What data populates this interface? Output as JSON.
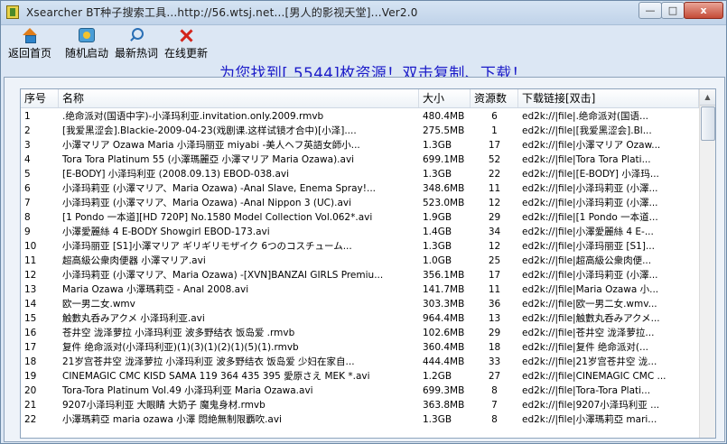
{
  "window": {
    "title": "Xsearcher BT种子搜索工具...http://56.wtsj.net...[男人的影视天堂]...Ver2.0",
    "min_label": "—",
    "max_label": "□",
    "close_label": "x"
  },
  "toolbar": {
    "home_label": "返回首页",
    "random_label": "随机启动",
    "hot_label": "最新热词",
    "update_label": "在线更新"
  },
  "banner": "为您找到[ 5544]枚资源！双击复制、下载！",
  "table": {
    "headers": {
      "index": "序号",
      "name": "名称",
      "size": "大小",
      "count": "资源数",
      "link": "下载链接[双击]"
    },
    "rows": [
      {
        "index": "1",
        "name": ".绝命派对(国语中字)-小泽玛利亚.invitation.only.2009.rmvb",
        "size": "480.4MB",
        "count": "6",
        "link": "ed2k://|file|.绝命派对(国语..."
      },
      {
        "index": "2",
        "name": "[我爱黑涩会].Blackie-2009-04-23(戏剧课.这样试镜才合中)[小泽]....",
        "size": "275.5MB",
        "count": "1",
        "link": "ed2k://|file|[我爱黑涩会].Bl..."
      },
      {
        "index": "3",
        "name": "小澤マリア Ozawa Maria 小泽玛丽亚 miyabi -美人ヘフ英語女師小...",
        "size": "1.3GB",
        "count": "17",
        "link": "ed2k://|file|小澤マリア Ozaw..."
      },
      {
        "index": "4",
        "name": "Tora Tora Platinum 55 (小澤瑪麗亞 小澤マリア Maria Ozawa).avi",
        "size": "699.1MB",
        "count": "52",
        "link": "ed2k://|file|Tora Tora Plati..."
      },
      {
        "index": "5",
        "name": "[E-BODY] 小泽玛利亚 (2008.09.13) EBOD-038.avi",
        "size": "1.3GB",
        "count": "22",
        "link": "ed2k://|file|[E-BODY] 小泽玛..."
      },
      {
        "index": "6",
        "name": "小泽玛莉亚 (小澤マリア、Maria Ozawa) -Anal Slave, Enema Spray!...",
        "size": "348.6MB",
        "count": "11",
        "link": "ed2k://|file|小泽玛莉亚 (小澤..."
      },
      {
        "index": "7",
        "name": "小泽玛莉亚 (小澤マリア、Maria Ozawa) -Anal Nippon 3 (UC).avi",
        "size": "523.0MB",
        "count": "12",
        "link": "ed2k://|file|小泽玛莉亚 (小澤..."
      },
      {
        "index": "8",
        "name": "[1 Pondo 一本道][HD 720P] No.1580 Model Collection Vol.062*.avi",
        "size": "1.9GB",
        "count": "29",
        "link": "ed2k://|file|[1 Pondo 一本道..."
      },
      {
        "index": "9",
        "name": "小澤愛麗絲 4 E-BODY Showgirl EBOD-173.avi",
        "size": "1.4GB",
        "count": "34",
        "link": "ed2k://|file|小澤愛麗絲 4 E-..."
      },
      {
        "index": "10",
        "name": "小泽玛丽亚 [S1]小澤マリア ギリギリモザイク 6つのコスチューム...",
        "size": "1.3GB",
        "count": "12",
        "link": "ed2k://|file|小泽玛丽亚 [S1]..."
      },
      {
        "index": "11",
        "name": "超高級公衆肉便器 小澤マリア.avi",
        "size": "1.0GB",
        "count": "25",
        "link": "ed2k://|file|超高級公衆肉便..."
      },
      {
        "index": "12",
        "name": "小泽玛莉亚 (小澤マリア、Maria Ozawa) -[XVN]BANZAI GIRLS Premiu...",
        "size": "356.1MB",
        "count": "17",
        "link": "ed2k://|file|小泽玛莉亚 (小澤..."
      },
      {
        "index": "13",
        "name": "Maria Ozawa 小澤瑪莉亞 - Anal 2008.avi",
        "size": "141.7MB",
        "count": "11",
        "link": "ed2k://|file|Maria Ozawa 小..."
      },
      {
        "index": "14",
        "name": "欧一男二女.wmv",
        "size": "303.3MB",
        "count": "36",
        "link": "ed2k://|file|欧一男二女.wmv..."
      },
      {
        "index": "15",
        "name": "触數丸呑みアクメ 小泽玛利亚.avi",
        "size": "964.4MB",
        "count": "13",
        "link": "ed2k://|file|触數丸呑みアクメ..."
      },
      {
        "index": "16",
        "name": "苍井空 泷泽萝拉 小泽玛利亚 波多野结衣 饭岛爱 .rmvb",
        "size": "102.6MB",
        "count": "29",
        "link": "ed2k://|file|苍井空 泷泽萝拉..."
      },
      {
        "index": "17",
        "name": "复件 绝命派对(小泽玛利亚)(1)(3)(1)(2)(1)(5)(1).rmvb",
        "size": "360.4MB",
        "count": "18",
        "link": "ed2k://|file|复件 绝命派对(..."
      },
      {
        "index": "18",
        "name": "21岁宫苍井空 泷泽萝拉 小泽玛利亚 波多野结衣 饭岛爱 少妇在家自...",
        "size": "444.4MB",
        "count": "33",
        "link": "ed2k://|file|21岁宫苍井空 泷..."
      },
      {
        "index": "19",
        "name": "CINEMAGIC CMC KISD SAMA 119 364 435 395 愛原さえ MEK *.avi",
        "size": "1.2GB",
        "count": "27",
        "link": "ed2k://|file|CINEMAGIC CMC ..."
      },
      {
        "index": "20",
        "name": "Tora-Tora Platinum Vol.49 小泽玛利亚 Maria Ozawa.avi",
        "size": "699.3MB",
        "count": "8",
        "link": "ed2k://|file|Tora-Tora Plati..."
      },
      {
        "index": "21",
        "name": "9207小泽玛利亚 大眼睛 大奶子 魔鬼身材.rmvb",
        "size": "363.8MB",
        "count": "7",
        "link": "ed2k://|file|9207小泽玛利亚 ..."
      },
      {
        "index": "22",
        "name": "小澤瑪莉亞 maria ozawa 小澤 悶絶無制限覇吹.avi",
        "size": "1.3GB",
        "count": "8",
        "link": "ed2k://|file|小澤瑪莉亞 mari..."
      }
    ]
  },
  "scrollbar": {
    "up_label": "▲"
  }
}
